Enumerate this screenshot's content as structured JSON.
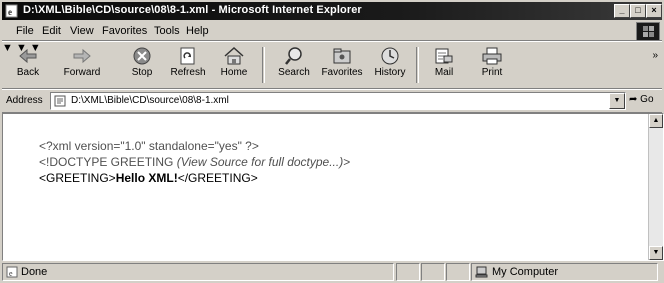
{
  "window": {
    "title": "D:\\XML\\Bible\\CD\\source\\08\\8-1.xml - Microsoft Internet Explorer",
    "minimize_glyph": "_",
    "maximize_glyph": "□",
    "close_glyph": "×"
  },
  "menu": {
    "file": "File",
    "edit": "Edit",
    "view": "View",
    "favorites": "Favorites",
    "tools": "Tools",
    "help": "Help"
  },
  "toolbar": {
    "back": "Back",
    "forward": "Forward",
    "stop": "Stop",
    "refresh": "Refresh",
    "home": "Home",
    "search": "Search",
    "favorites": "Favorites",
    "history": "History",
    "mail": "Mail",
    "print": "Print",
    "more": "»"
  },
  "address": {
    "label": "Address",
    "value": "D:\\XML\\Bible\\CD\\source\\08\\8-1.xml",
    "go": "Go"
  },
  "document": {
    "line1": "<?xml version=\"1.0\" standalone=\"yes\" ?>",
    "line2_prefix": "<!DOCTYPE GREETING ",
    "line2_italic": "(View Source for full doctype...)",
    "line2_suffix": ">",
    "line3_open": "<GREETING>",
    "line3_text": "Hello XML!",
    "line3_close": "</GREETING>"
  },
  "status": {
    "text": "Done",
    "zone": "My Computer"
  },
  "icons": [
    "ie-page-icon",
    "back-arrow-icon",
    "forward-arrow-icon",
    "stop-icon",
    "refresh-icon",
    "home-icon",
    "search-icon",
    "favorites-icon",
    "history-icon",
    "mail-icon",
    "print-icon",
    "windows-throbber-icon",
    "xml-file-icon",
    "go-arrow-icon",
    "computer-icon"
  ]
}
